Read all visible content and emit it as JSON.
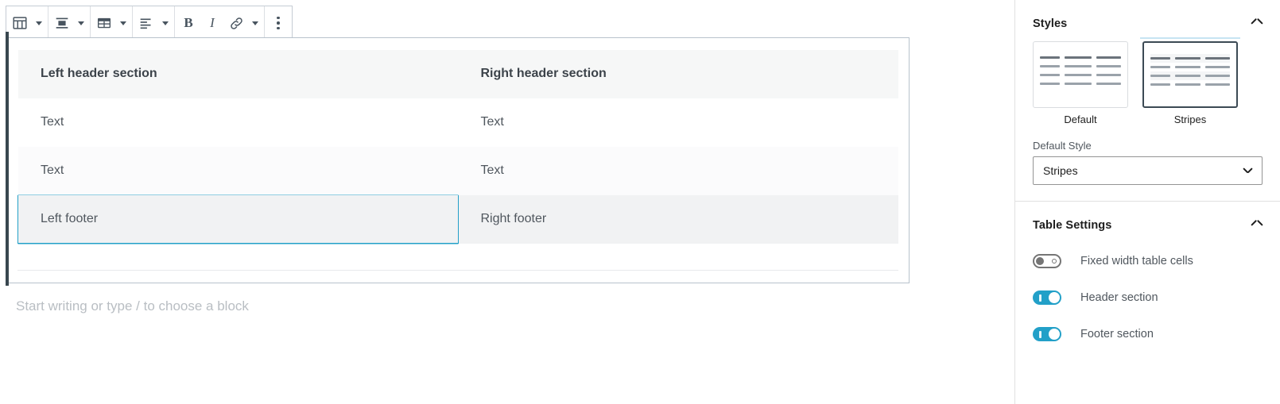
{
  "toolbar": {
    "groups": [
      {
        "icon": "table-block-icon",
        "label": "Table block type",
        "has_caret": true,
        "caret_name": "block-type-caret"
      },
      {
        "icon": "align-center-icon",
        "label": "Change alignment",
        "has_caret": true,
        "caret_name": "align-caret"
      },
      {
        "icon": "edit-table-icon",
        "label": "Edit table",
        "has_caret": true,
        "caret_name": "edit-table-caret"
      },
      {
        "icon": "text-align-icon",
        "label": "Change text alignment",
        "has_caret": true,
        "caret_name": "text-align-caret"
      }
    ],
    "format": {
      "bold_label": "B",
      "italic_label": "I",
      "link_name": "link-icon",
      "more_formats_caret": "more-formats-caret"
    },
    "options_label": "Options"
  },
  "table": {
    "header": [
      "Left header section",
      "Right header section"
    ],
    "body": [
      [
        "Text",
        "Text"
      ],
      [
        "Text",
        "Text"
      ]
    ],
    "footer": [
      "Left footer",
      "Right footer"
    ],
    "selected_cell": "Left footer"
  },
  "editor": {
    "placeholder": "Start writing or type / to choose a block"
  },
  "sidebar": {
    "styles_panel": {
      "title": "Styles",
      "options": [
        {
          "label": "Default",
          "selected": false
        },
        {
          "label": "Stripes",
          "selected": true
        }
      ],
      "default_style": {
        "label": "Default Style",
        "value": "Stripes"
      }
    },
    "table_settings_panel": {
      "title": "Table Settings",
      "toggles": [
        {
          "label": "Fixed width table cells",
          "on": false
        },
        {
          "label": "Header section",
          "on": true
        },
        {
          "label": "Footer section",
          "on": true
        }
      ]
    }
  },
  "colors": {
    "accent": "#22a0c8",
    "selection_border": "#23a0c8",
    "toolbar_icon": "#48545f",
    "header_bg": "#f6f7f7",
    "footer_bg": "#f1f2f3"
  }
}
